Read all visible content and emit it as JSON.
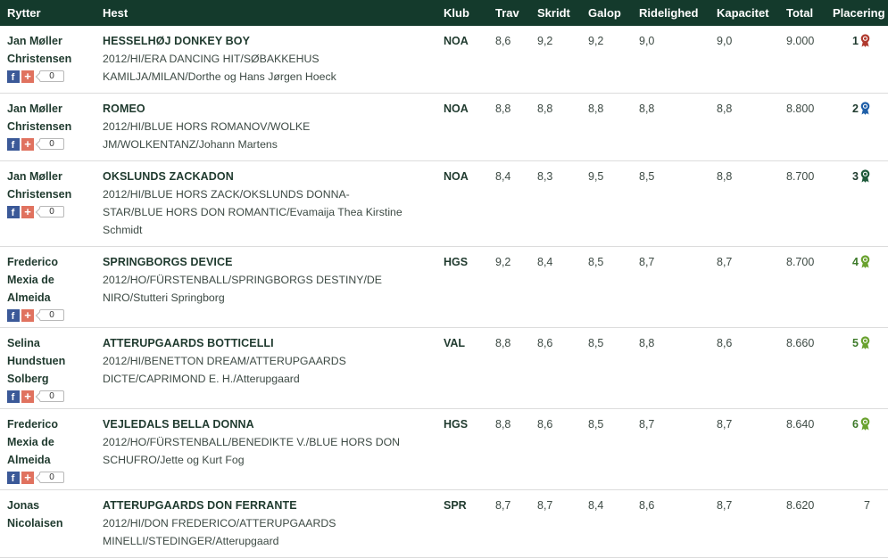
{
  "headers": {
    "rider": "Rytter",
    "horse": "Hest",
    "club": "Klub",
    "trav": "Trav",
    "skridt": "Skridt",
    "galop": "Galop",
    "ridelighed": "Ridelighed",
    "kapacitet": "Kapacitet",
    "total": "Total",
    "placering": "Placering"
  },
  "social": {
    "facebook_glyph": "f",
    "plus_glyph": "+"
  },
  "rosette_colors": {
    "1": "#b03a2e",
    "2": "#1f5fa8",
    "3": "#1e5a3a",
    "other": "#6aa22f"
  },
  "rows": [
    {
      "rider": [
        "Jan Møller",
        "Christensen"
      ],
      "horse_name": "HESSELHØJ DONKEY BOY",
      "horse_desc": [
        "2012/HI/ERA DANCING HIT/SØBAKKEHUS",
        "KAMILJA/MILAN/Dorthe og Hans Jørgen Hoeck"
      ],
      "club": "NOA",
      "trav": "8,6",
      "skridt": "9,2",
      "galop": "9,2",
      "ridelighed": "9,0",
      "kapacitet": "9,0",
      "total": "9.000",
      "placement": "1",
      "rosette": "1",
      "share_count": "0"
    },
    {
      "rider": [
        "Jan Møller",
        "Christensen"
      ],
      "horse_name": "ROMEO",
      "horse_desc": [
        "2012/HI/BLUE HORS ROMANOV/WOLKE",
        "JM/WOLKENTANZ/Johann Martens"
      ],
      "club": "NOA",
      "trav": "8,8",
      "skridt": "8,8",
      "galop": "8,8",
      "ridelighed": "8,8",
      "kapacitet": "8,8",
      "total": "8.800",
      "placement": "2",
      "rosette": "2",
      "share_count": "0"
    },
    {
      "rider": [
        "Jan Møller",
        "Christensen"
      ],
      "horse_name": "OKSLUNDS ZACKADON",
      "horse_desc": [
        "2012/HI/BLUE HORS ZACK/OKSLUNDS DONNA-",
        "STAR/BLUE HORS DON ROMANTIC/Evamaija Thea Kirstine",
        "Schmidt"
      ],
      "club": "NOA",
      "trav": "8,4",
      "skridt": "8,3",
      "galop": "9,5",
      "ridelighed": "8,5",
      "kapacitet": "8,8",
      "total": "8.700",
      "placement": "3",
      "rosette": "3",
      "share_count": "0"
    },
    {
      "rider": [
        "Frederico",
        "Mexia de",
        "Almeida"
      ],
      "horse_name": "SPRINGBORGS DEVICE",
      "horse_desc": [
        "2012/HO/FÜRSTENBALL/SPRINGBORGS DESTINY/DE",
        "NIRO/Stutteri Springborg"
      ],
      "club": "HGS",
      "trav": "9,2",
      "skridt": "8,4",
      "galop": "8,5",
      "ridelighed": "8,7",
      "kapacitet": "8,7",
      "total": "8.700",
      "placement": "4",
      "rosette": "other",
      "share_count": "0"
    },
    {
      "rider": [
        "Selina",
        "Hundstuen",
        "Solberg"
      ],
      "horse_name": "ATTERUPGAARDS BOTTICELLI",
      "horse_desc": [
        "2012/HI/BENETTON DREAM/ATTERUPGAARDS",
        "DICTE/CAPRIMOND E. H./Atterupgaard"
      ],
      "club": "VAL",
      "trav": "8,8",
      "skridt": "8,6",
      "galop": "8,5",
      "ridelighed": "8,8",
      "kapacitet": "8,6",
      "total": "8.660",
      "placement": "5",
      "rosette": "other",
      "share_count": "0"
    },
    {
      "rider": [
        "Frederico",
        "Mexia de",
        "Almeida"
      ],
      "horse_name": "VEJLEDALS BELLA DONNA",
      "horse_desc": [
        "2012/HO/FÜRSTENBALL/BENEDIKTE V./BLUE HORS DON",
        "SCHUFRO/Jette og Kurt Fog"
      ],
      "club": "HGS",
      "trav": "8,8",
      "skridt": "8,6",
      "galop": "8,5",
      "ridelighed": "8,7",
      "kapacitet": "8,7",
      "total": "8.640",
      "placement": "6",
      "rosette": "other",
      "share_count": "0"
    },
    {
      "rider": [
        "Jonas",
        "Nicolaisen"
      ],
      "horse_name": "ATTERUPGAARDS DON FERRANTE",
      "horse_desc": [
        "2012/HI/DON FREDERICO/ATTERUPGAARDS",
        "MINELLI/STEDINGER/Atterupgaard"
      ],
      "club": "SPR",
      "trav": "8,7",
      "skridt": "8,7",
      "galop": "8,4",
      "ridelighed": "8,6",
      "kapacitet": "8,7",
      "total": "8.620",
      "placement": "7",
      "rosette": null,
      "share_count": null
    }
  ]
}
